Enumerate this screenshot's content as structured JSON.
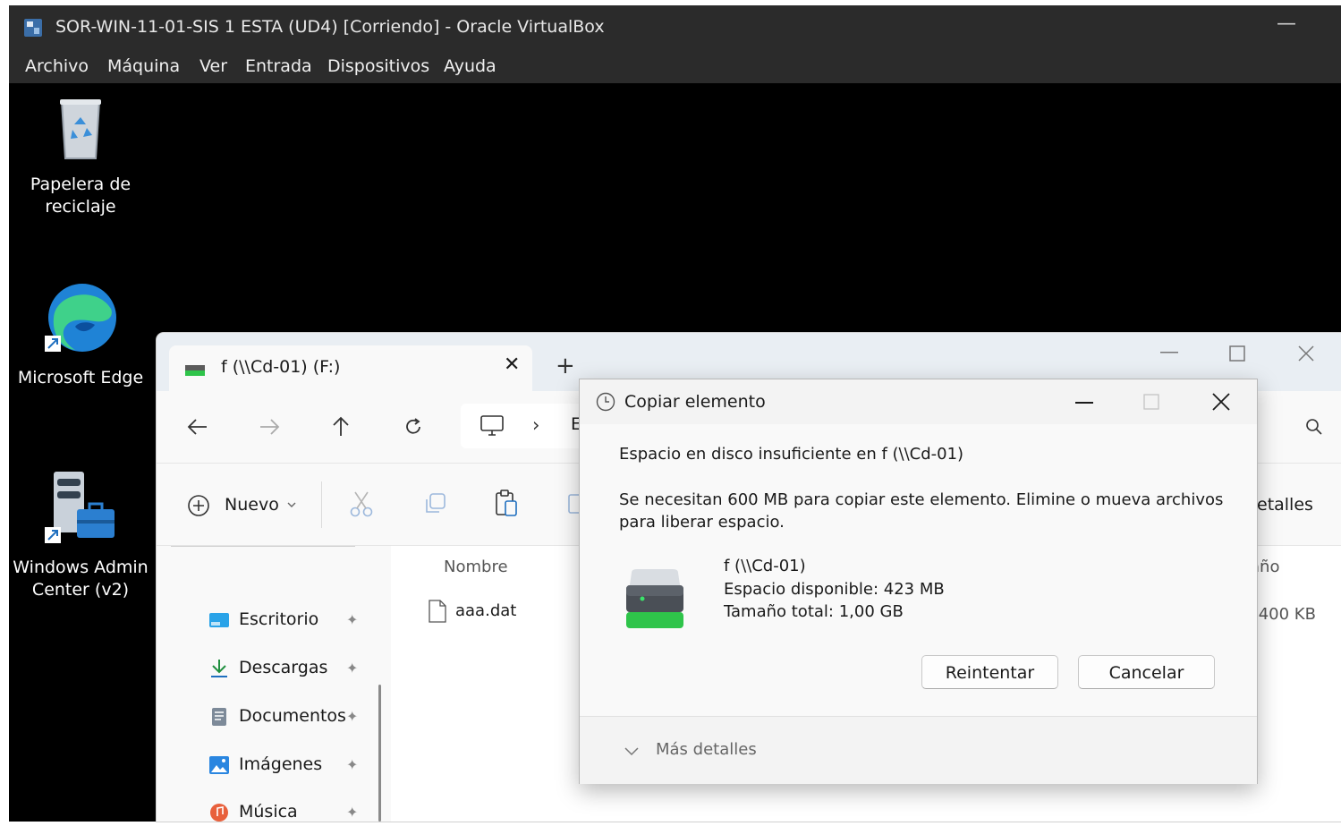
{
  "vm_window": {
    "title": "SOR-WIN-11-01-SIS 1  ESTA (UD4) [Corriendo] - Oracle VirtualBox",
    "minimize_glyph": "—",
    "menu": [
      "Archivo",
      "Máquina",
      "Ver",
      "Entrada",
      "Dispositivos",
      "Ayuda"
    ]
  },
  "desktop": {
    "icons": [
      {
        "label": "Papelera de reciclaje",
        "icon": "recycle-bin-icon"
      },
      {
        "label": "Microsoft Edge",
        "icon": "edge-icon"
      },
      {
        "label": "Windows Admin Center (v2)",
        "icon": "windows-admin-center-icon"
      }
    ]
  },
  "explorer": {
    "tab_title": "f (\\\\Cd-01) (F:)",
    "tab_close": "✕",
    "new_tab": "+",
    "address_sep": "›",
    "address_partial": "E",
    "new_button": "Nuevo",
    "details_partial": "etalles",
    "column_name": "Nombre",
    "column_size_partial": "año",
    "files": [
      {
        "name": "aaa.dat",
        "size_partial": ".400 KB"
      }
    ],
    "quick_access": [
      {
        "label": "Escritorio",
        "icon": "desktop-folder-icon"
      },
      {
        "label": "Descargas",
        "icon": "download-icon"
      },
      {
        "label": "Documentos",
        "icon": "documents-icon"
      },
      {
        "label": "Imágenes",
        "icon": "pictures-icon"
      },
      {
        "label": "Música",
        "icon": "music-icon"
      }
    ]
  },
  "dialog": {
    "title": "Copiar elemento",
    "heading": "Espacio en disco insuficiente en f (\\\\Cd-01)",
    "message_line1": "Se necesitan 600 MB para copiar este elemento. Elimine o mueva archivos",
    "message_line2": "para liberar espacio.",
    "drive_name": "f (\\\\Cd-01)",
    "free_space": "Espacio disponible: 423 MB",
    "total_size": "Tamaño total: 1,00 GB",
    "retry_button": "Reintentar",
    "cancel_button": "Cancelar",
    "more_details": "Más detalles"
  },
  "colors": {
    "vbox_bar": "#2b2b2b",
    "desktop_bg": "#000000",
    "drive_green": "#2fc44a"
  }
}
